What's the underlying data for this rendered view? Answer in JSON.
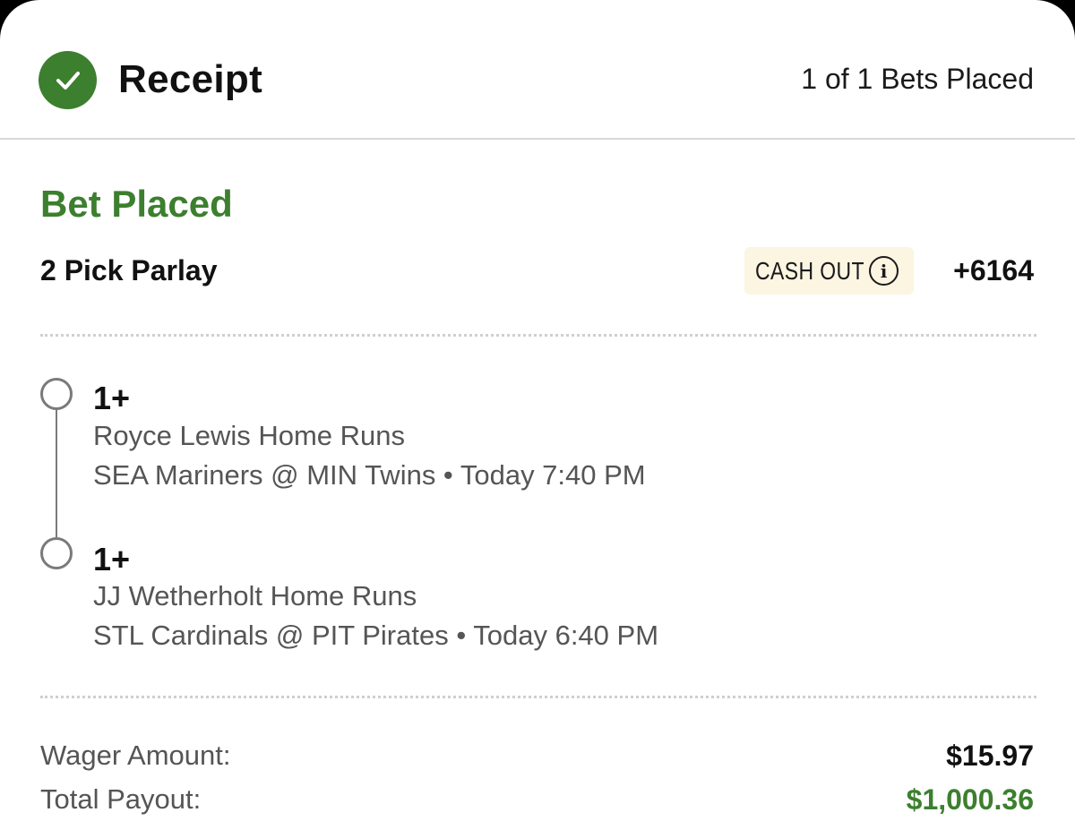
{
  "header": {
    "title": "Receipt",
    "status": "1 of 1 Bets Placed"
  },
  "bet": {
    "status_label": "Bet Placed",
    "type_label": "2 Pick Parlay",
    "cashout_label": "CASH OUT",
    "odds": "+6164",
    "legs": [
      {
        "value": "1+",
        "market": "Royce Lewis Home Runs",
        "game": "SEA Mariners @ MIN Twins • Today 7:40 PM"
      },
      {
        "value": "1+",
        "market": "JJ Wetherholt Home Runs",
        "game": "STL Cardinals @ PIT Pirates • Today 6:40 PM"
      }
    ]
  },
  "summary": {
    "wager_label": "Wager Amount:",
    "wager_value": "$15.97",
    "payout_label": "Total Payout:",
    "payout_value": "$1,000.36"
  },
  "colors": {
    "accent_green": "#3c7f2e",
    "cashout_bg": "#fbf5e1"
  },
  "icons": {
    "check": "check-icon",
    "info": "info-icon"
  }
}
